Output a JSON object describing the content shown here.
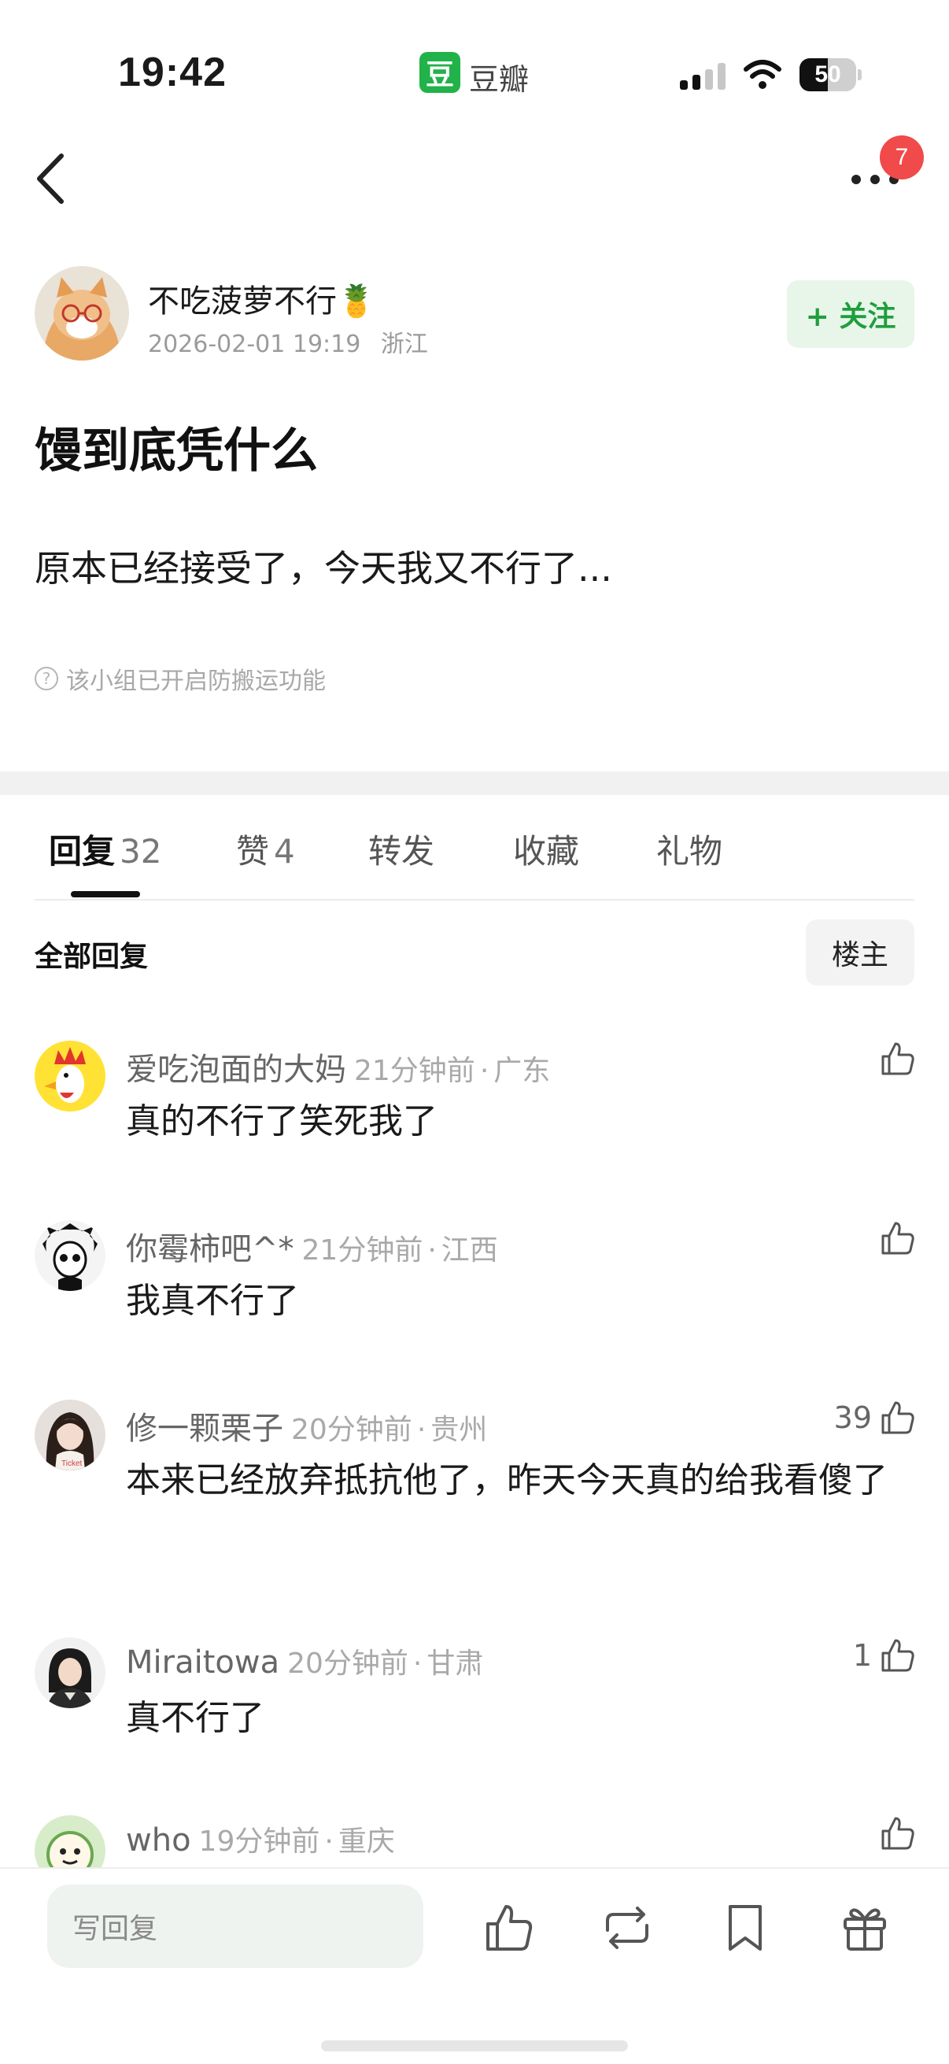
{
  "status_bar": {
    "time": "19:42",
    "app_logo_char": "豆",
    "app_name": "豆瓣",
    "battery_level": "50",
    "battery_percent": 50
  },
  "nav": {
    "notification_count": "7"
  },
  "post": {
    "author": "不吃菠萝不行🍍",
    "date": "2026-02-01 19:19",
    "location": "浙江",
    "follow_label": "+ 关注",
    "title": "馒到底凭什么",
    "body": "原本已经接受了，今天我又不行了...",
    "protect_note": "该小组已开启防搬运功能"
  },
  "tabs": [
    {
      "label": "回复",
      "count": "32",
      "active": true
    },
    {
      "label": "赞",
      "count": "4",
      "active": false
    },
    {
      "label": "转发",
      "count": "",
      "active": false
    },
    {
      "label": "收藏",
      "count": "",
      "active": false
    },
    {
      "label": "礼物",
      "count": "",
      "active": false
    }
  ],
  "replies_header": {
    "title": "全部回复",
    "op_filter": "楼主"
  },
  "comments": [
    {
      "user": "爱吃泡面的大妈",
      "time": "21分钟前",
      "location": "广东",
      "text": "真的不行了笑死我了",
      "likes": ""
    },
    {
      "user": "你霉柿吧^*",
      "time": "21分钟前",
      "location": "江西",
      "text": "我真不行了",
      "likes": ""
    },
    {
      "user": "修一颗栗子",
      "time": "20分钟前",
      "location": "贵州",
      "text": "本来已经放弃抵抗他了，昨天今天真的给我看傻了",
      "likes": "39"
    },
    {
      "user": "Miraitowa",
      "time": "20分钟前",
      "location": "甘肃",
      "text": "真不行了",
      "likes": "1"
    },
    {
      "user": "who",
      "time": "19分钟前",
      "location": "重庆",
      "text": "",
      "likes": ""
    }
  ],
  "bottom_bar": {
    "reply_placeholder": "写回复"
  },
  "colors": {
    "brand_green": "#21b24a",
    "follow_text": "#1f9e3d",
    "badge_red": "#f04a4a"
  },
  "icons": [
    "back-arrow-icon",
    "more-icon",
    "signal-icon",
    "wifi-icon",
    "battery-icon",
    "like-icon",
    "repost-icon",
    "bookmark-icon",
    "gift-icon",
    "question-icon"
  ]
}
